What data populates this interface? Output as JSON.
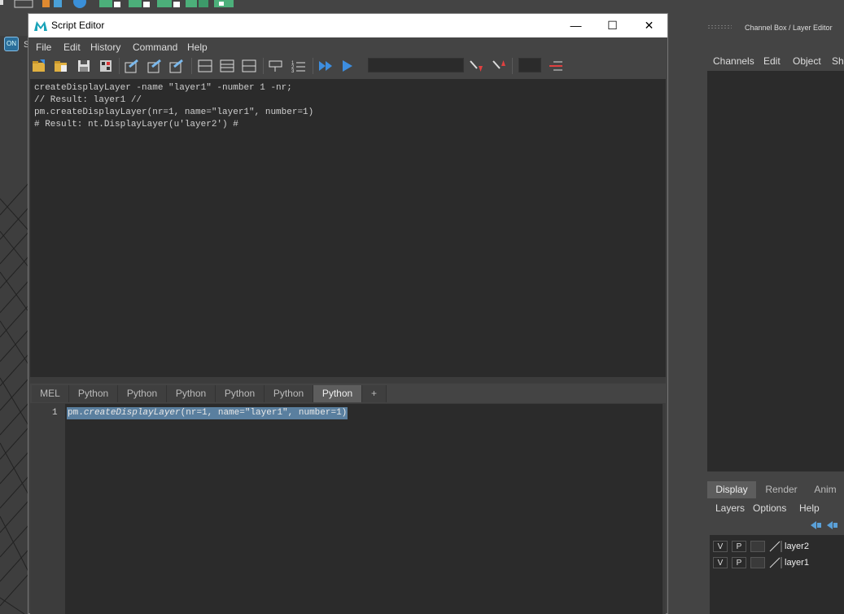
{
  "window": {
    "title": "Script Editor",
    "controls": {
      "minimize": "—",
      "maximize": "☐",
      "close": "✕"
    }
  },
  "menubar": [
    "File",
    "Edit",
    "History",
    "Command",
    "Help"
  ],
  "history_lines": [
    "createDisplayLayer -name \"layer1\" -number 1 -nr;",
    "// Result: layer1 //",
    "pm.createDisplayLayer(nr=1, name=\"layer1\", number=1)",
    "# Result: nt.DisplayLayer(u'layer2') #"
  ],
  "tabs": [
    {
      "label": "MEL",
      "active": false
    },
    {
      "label": "Python",
      "active": false
    },
    {
      "label": "Python",
      "active": false
    },
    {
      "label": "Python",
      "active": false
    },
    {
      "label": "Python",
      "active": false
    },
    {
      "label": "Python",
      "active": false
    },
    {
      "label": "Python",
      "active": true
    },
    {
      "label": "+",
      "active": false
    }
  ],
  "input": {
    "line_number": "1",
    "code_prefix": "pm.",
    "code_function": "createDisplayLayer",
    "code_args": "(nr=1, name=\"layer1\", number=1)"
  },
  "channel_box": {
    "title": "Channel Box / Layer Editor",
    "menu": [
      "Channels",
      "Edit",
      "Object",
      "Sh"
    ]
  },
  "layer_editor": {
    "tabs": [
      {
        "label": "Display",
        "active": true
      },
      {
        "label": "Render",
        "active": false
      },
      {
        "label": "Anim",
        "active": false
      }
    ],
    "menu": [
      "Layers",
      "Options",
      "Help"
    ],
    "layers": [
      {
        "v": "V",
        "p": "P",
        "name": "layer2"
      },
      {
        "v": "V",
        "p": "P",
        "name": "layer1"
      }
    ]
  },
  "viewport": {
    "mode_letter": "S"
  },
  "colors": {
    "panel_bg": "#444444",
    "field_bg": "#2b2b2b",
    "active_tab": "#5d5d5d",
    "selection": "#5a7f9f",
    "accent_blue": "#3d8ee0"
  }
}
